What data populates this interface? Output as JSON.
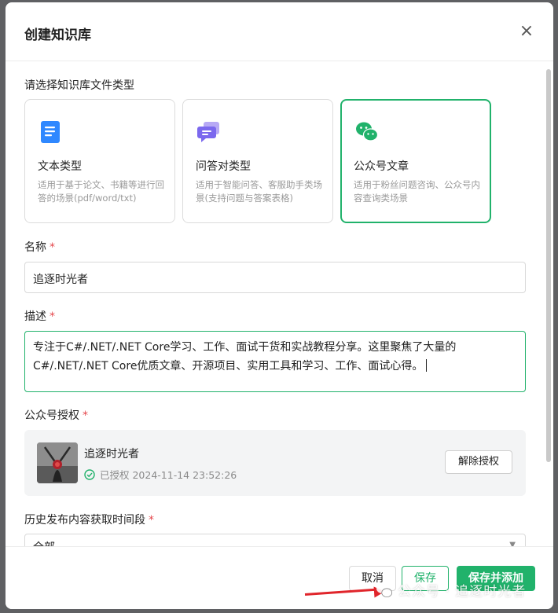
{
  "dialog": {
    "title": "创建知识库",
    "close_label": "×"
  },
  "file_type": {
    "label": "请选择知识库文件类型",
    "options": [
      {
        "name": "文本类型",
        "desc": "适用于基于论文、书籍等进行回答的场景(pdf/word/txt)",
        "icon": "document-icon",
        "color": "#2f88ff",
        "selected": false
      },
      {
        "name": "问答对类型",
        "desc": "适用于智能问答、客服助手类场景(支持问题与答案表格)",
        "icon": "chat-bubbles-icon",
        "color": "#7b68ee",
        "selected": false
      },
      {
        "name": "公众号文章",
        "desc": "适用于粉丝问题咨询、公众号内容查询类场景",
        "icon": "wechat-icon",
        "color": "#21b26b",
        "selected": true
      }
    ]
  },
  "name_field": {
    "label": "名称",
    "required": "*",
    "value": "追逐时光者"
  },
  "description_field": {
    "label": "描述",
    "required": "*",
    "value": "专注于C#/.NET/.NET Core学习、工作、面试干货和实战教程分享。这里聚焦了大量的C#/.NET/.NET Core优质文章、开源项目、实用工具和学习、工作、面试心得。"
  },
  "account_auth": {
    "label": "公众号授权",
    "required": "*",
    "account_name": "追逐时光者",
    "status_text": "已授权 2024-11-14 23:52:26",
    "revoke_label": "解除授权"
  },
  "history_range": {
    "label": "历史发布内容获取时间段",
    "required": "*",
    "selected": "全部"
  },
  "footer": {
    "cancel_label": "取消",
    "save_label": "保存",
    "save_add_label": "保存并添加"
  },
  "watermark": {
    "text": "公众号 · 追逐时光者"
  },
  "colors": {
    "accent": "#21b26b",
    "required": "#e5484d"
  }
}
